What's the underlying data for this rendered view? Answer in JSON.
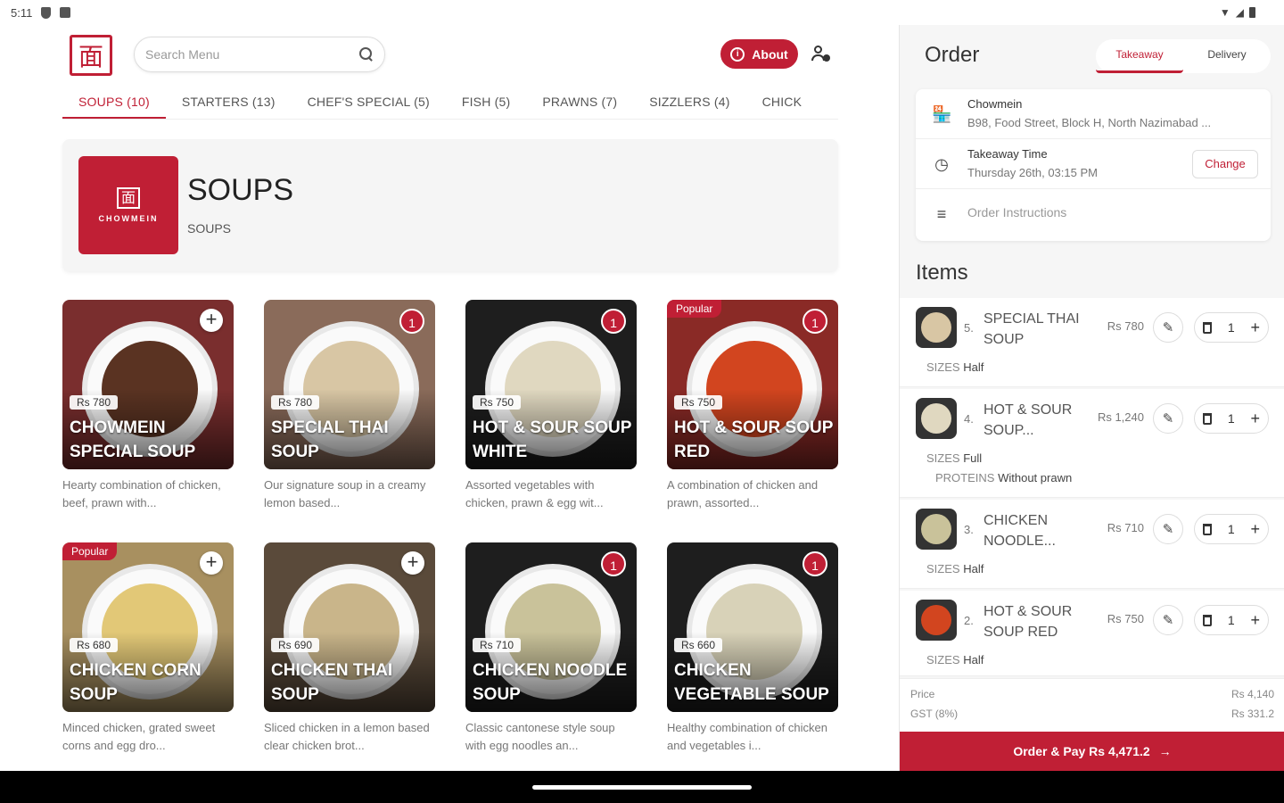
{
  "status": {
    "time": "5:11"
  },
  "header": {
    "search_placeholder": "Search Menu",
    "about_label": "About",
    "logo_glyph": "面"
  },
  "categories": [
    {
      "label": "SOUPS (10)",
      "active": true
    },
    {
      "label": "STARTERS (13)"
    },
    {
      "label": "CHEF'S SPECIAL (5)"
    },
    {
      "label": "FISH (5)"
    },
    {
      "label": "PRAWNS (7)"
    },
    {
      "label": "SIZZLERS (4)"
    },
    {
      "label": "CHICK"
    }
  ],
  "section": {
    "title": "SOUPS",
    "subtitle": "SOUPS",
    "logo_glyph": "面",
    "logo_name": "CHOWMEIN"
  },
  "menu_items": [
    {
      "name": "CHOWMEIN SPECIAL SOUP",
      "price": "Rs 780",
      "desc": "Hearty combination of chicken, beef, prawn with...",
      "qty": "",
      "popular": false,
      "bg": "#7a2e2e",
      "soup": "#5a3322"
    },
    {
      "name": "SPECIAL THAI SOUP",
      "price": "Rs 780",
      "desc": "Our signature soup in a creamy lemon based...",
      "qty": "1",
      "popular": false,
      "bg": "#8a6b5a",
      "soup": "#d8c6a4"
    },
    {
      "name": "HOT & SOUR SOUP WHITE",
      "price": "Rs 750",
      "desc": "Assorted vegetables with chicken, prawn & egg wit...",
      "qty": "1",
      "popular": false,
      "bg": "#1e1e1e",
      "soup": "#e0d8c0"
    },
    {
      "name": "HOT & SOUR SOUP RED",
      "price": "Rs 750",
      "desc": "A combination of chicken and prawn, assorted...",
      "qty": "1",
      "popular": true,
      "bg": "#8a2a26",
      "soup": "#d2451f"
    },
    {
      "name": "CHICKEN CORN SOUP",
      "price": "Rs 680",
      "desc": "Minced chicken, grated sweet corns and egg dro...",
      "qty": "",
      "popular": true,
      "bg": "#a89060",
      "soup": "#e2c877"
    },
    {
      "name": "CHICKEN THAI SOUP",
      "price": "Rs 690",
      "desc": "Sliced chicken in a lemon based clear chicken brot...",
      "qty": "",
      "popular": false,
      "bg": "#5a4a3a",
      "soup": "#c9b58a"
    },
    {
      "name": "CHICKEN NOODLE SOUP",
      "price": "Rs 710",
      "desc": "Classic cantonese style soup with egg noodles an...",
      "qty": "1",
      "popular": false,
      "bg": "#1e1e1e",
      "soup": "#c9c29a"
    },
    {
      "name": "CHICKEN VEGETABLE SOUP",
      "price": "Rs 660",
      "desc": "Healthy combination of chicken and vegetables i...",
      "qty": "1",
      "popular": false,
      "bg": "#1e1e1e",
      "soup": "#d8d2b8"
    }
  ],
  "labels": {
    "popular": "Popular",
    "sizes": "SIZES",
    "proteins": "PROTEINS"
  },
  "order": {
    "title": "Order",
    "modes": [
      "Takeaway",
      "Delivery"
    ],
    "active_mode": 0,
    "branch_name": "Chowmein",
    "branch_address": "B98, Food Street, Block H, North Nazimabad ...",
    "time_label": "Takeaway Time",
    "time_value": "Thursday 26th, 03:15 PM",
    "change_label": "Change",
    "instructions_placeholder": "Order Instructions",
    "items_title": "Items",
    "items": [
      {
        "index": "5.",
        "name": "SPECIAL THAI SOUP",
        "price": "Rs 780",
        "qty": "1",
        "size": "Half",
        "protein": "",
        "soup": "#d8c6a4"
      },
      {
        "index": "4.",
        "name": "HOT & SOUR SOUP...",
        "price": "Rs 1,240",
        "qty": "1",
        "size": "Full",
        "protein": "Without prawn",
        "soup": "#e0d8c0"
      },
      {
        "index": "3.",
        "name": "CHICKEN NOODLE...",
        "price": "Rs 710",
        "qty": "1",
        "size": "Half",
        "protein": "",
        "soup": "#c9c29a"
      },
      {
        "index": "2.",
        "name": "HOT & SOUR SOUP RED",
        "price": "Rs 750",
        "qty": "1",
        "size": "Half",
        "protein": "",
        "soup": "#d2451f"
      }
    ],
    "price_label": "Price",
    "price_value": "Rs 4,140",
    "gst_label": "GST (8%)",
    "gst_value": "Rs 331.2",
    "pay_label": "Order & Pay Rs 4,471.2"
  },
  "colors": {
    "accent": "#c01f35"
  }
}
